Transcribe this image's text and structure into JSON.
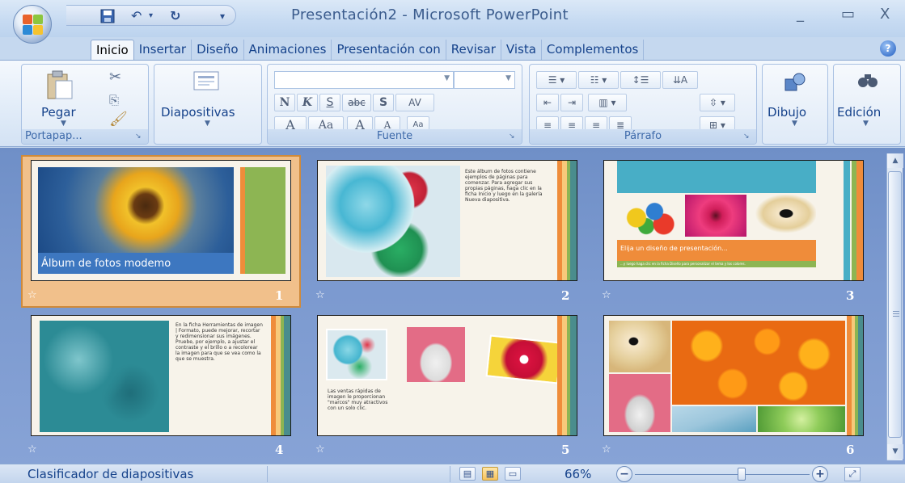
{
  "window": {
    "title": "Presentación2 - Microsoft PowerPoint",
    "minimize_label": "_",
    "maximize_label": "▭",
    "close_label": "X"
  },
  "quick_access": {
    "save_icon": "save-icon",
    "undo_label": "↶",
    "redo_label": "↻",
    "dropdown_label": "▾"
  },
  "tabs": [
    "Inicio",
    "Insertar",
    "Diseño",
    "Animaciones",
    "Presentación con",
    "Revisar",
    "Vista",
    "Complementos"
  ],
  "ribbon": {
    "clipboard": {
      "paste_label": "Pegar",
      "group_label": "Portapap..."
    },
    "slides": {
      "slides_label": "Diapositivas"
    },
    "font": {
      "group_label": "Fuente",
      "bold": "N",
      "italic": "K",
      "underline": "S",
      "strike": "abc",
      "shadow": "S",
      "spacing": "AV",
      "case": "Aa",
      "grow": "A",
      "shrink": "A",
      "clear": "A"
    },
    "paragraph": {
      "group_label": "Párrafo"
    },
    "drawing": {
      "label": "Dibujo"
    },
    "editing": {
      "label": "Edición"
    }
  },
  "slides": [
    {
      "number": "1",
      "caption": "Álbum de fotos modemo",
      "selected": true
    },
    {
      "number": "2",
      "body": "Este álbum de fotos contiene ejemplos de páginas para comenzar. Para agregar sus propias páginas, haga clic en la ficha Inicio y luego en la galería Nueva diapositiva."
    },
    {
      "number": "3",
      "heading": "Elija un diseño de presentación...",
      "sub": "...y luego haga clic en la ficha Diseño para personalizar el tema y los colores."
    },
    {
      "number": "4",
      "body": "En la ficha Herramientas de imagen | Formato, puede mejorar, recortar y redimensionar sus imágenes. Pruebe, por ejemplo, a ajustar el contraste y el brillo o a recolorear la imagen para que se vea como la que se muestra."
    },
    {
      "number": "5",
      "body": "Las ventas rápidas de imagen le proporcionan \"marcos\" muy atractivos con un solo clic."
    },
    {
      "number": "6"
    }
  ],
  "status_bar": {
    "view_name": "Clasificador de diapositivas",
    "zoom": "66%",
    "zoom_minus": "−",
    "zoom_plus": "+"
  },
  "colors": {
    "accent_orange": "#ef8c3a",
    "accent_green": "#8db553",
    "slide_bg": "#f7f3ea",
    "sorter_bg": "#7b99cf"
  }
}
